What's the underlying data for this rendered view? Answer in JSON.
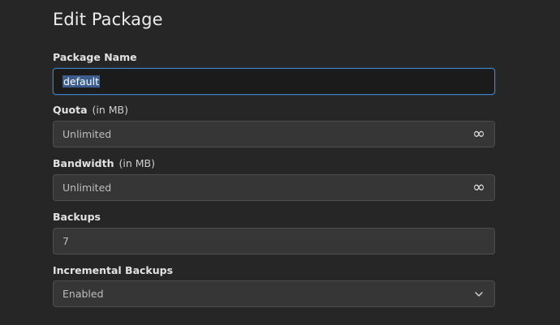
{
  "page": {
    "title": "Edit Package"
  },
  "fields": {
    "package_name": {
      "label": "Package Name",
      "value": "default"
    },
    "quota": {
      "label": "Quota",
      "unit": "(in MB)",
      "placeholder": "Unlimited",
      "suffix_icon": "infinity-icon",
      "suffix_glyph": "∞"
    },
    "bandwidth": {
      "label": "Bandwidth",
      "unit": "(in MB)",
      "placeholder": "Unlimited",
      "suffix_icon": "infinity-icon",
      "suffix_glyph": "∞"
    },
    "backups": {
      "label": "Backups",
      "value": "7"
    },
    "incremental_backups": {
      "label": "Incremental Backups",
      "selected": "Enabled",
      "icon": "chevron-down-icon"
    }
  },
  "colors": {
    "background": "#262626",
    "field_bg": "#363636",
    "focus_border": "#3f7fbf",
    "selection_bg": "#3d5e8c"
  }
}
